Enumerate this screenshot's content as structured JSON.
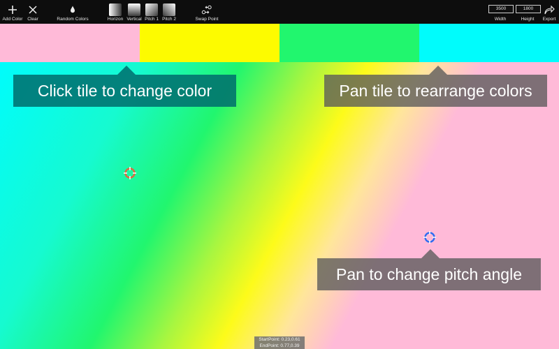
{
  "toolbar": {
    "add_color": "Add Color",
    "clear": "Clear",
    "random_colors": "Random Colors",
    "horizon": "Horizon",
    "vertical": "Vertical",
    "pitch1": "Pitch 1",
    "pitch2": "Pitch 2",
    "swap_point": "Swap Point",
    "width_value": "3500",
    "height_value": "1800",
    "width_label": "Width",
    "height_label": "Height",
    "export": "Export"
  },
  "tiles": [
    {
      "color": "#ffbad8"
    },
    {
      "color": "#fdfb00"
    },
    {
      "color": "#21f66e"
    },
    {
      "color": "#00fcfc"
    }
  ],
  "tooltips": {
    "tile_color": "Click tile to change color",
    "rearrange": "Pan tile to rearrange colors",
    "pitch": "Pan to change pitch angle"
  },
  "handles": {
    "start_color": "#e0673f",
    "end_color": "#2f6df0"
  },
  "status": {
    "start": "StartPoint: 0.23,0.61",
    "end": "EndPoint: 0.77,0.39"
  },
  "icons": {
    "add": "plus-icon",
    "clear": "close-icon",
    "random": "drop-icon",
    "swap": "swap-icon",
    "export": "export-icon"
  }
}
